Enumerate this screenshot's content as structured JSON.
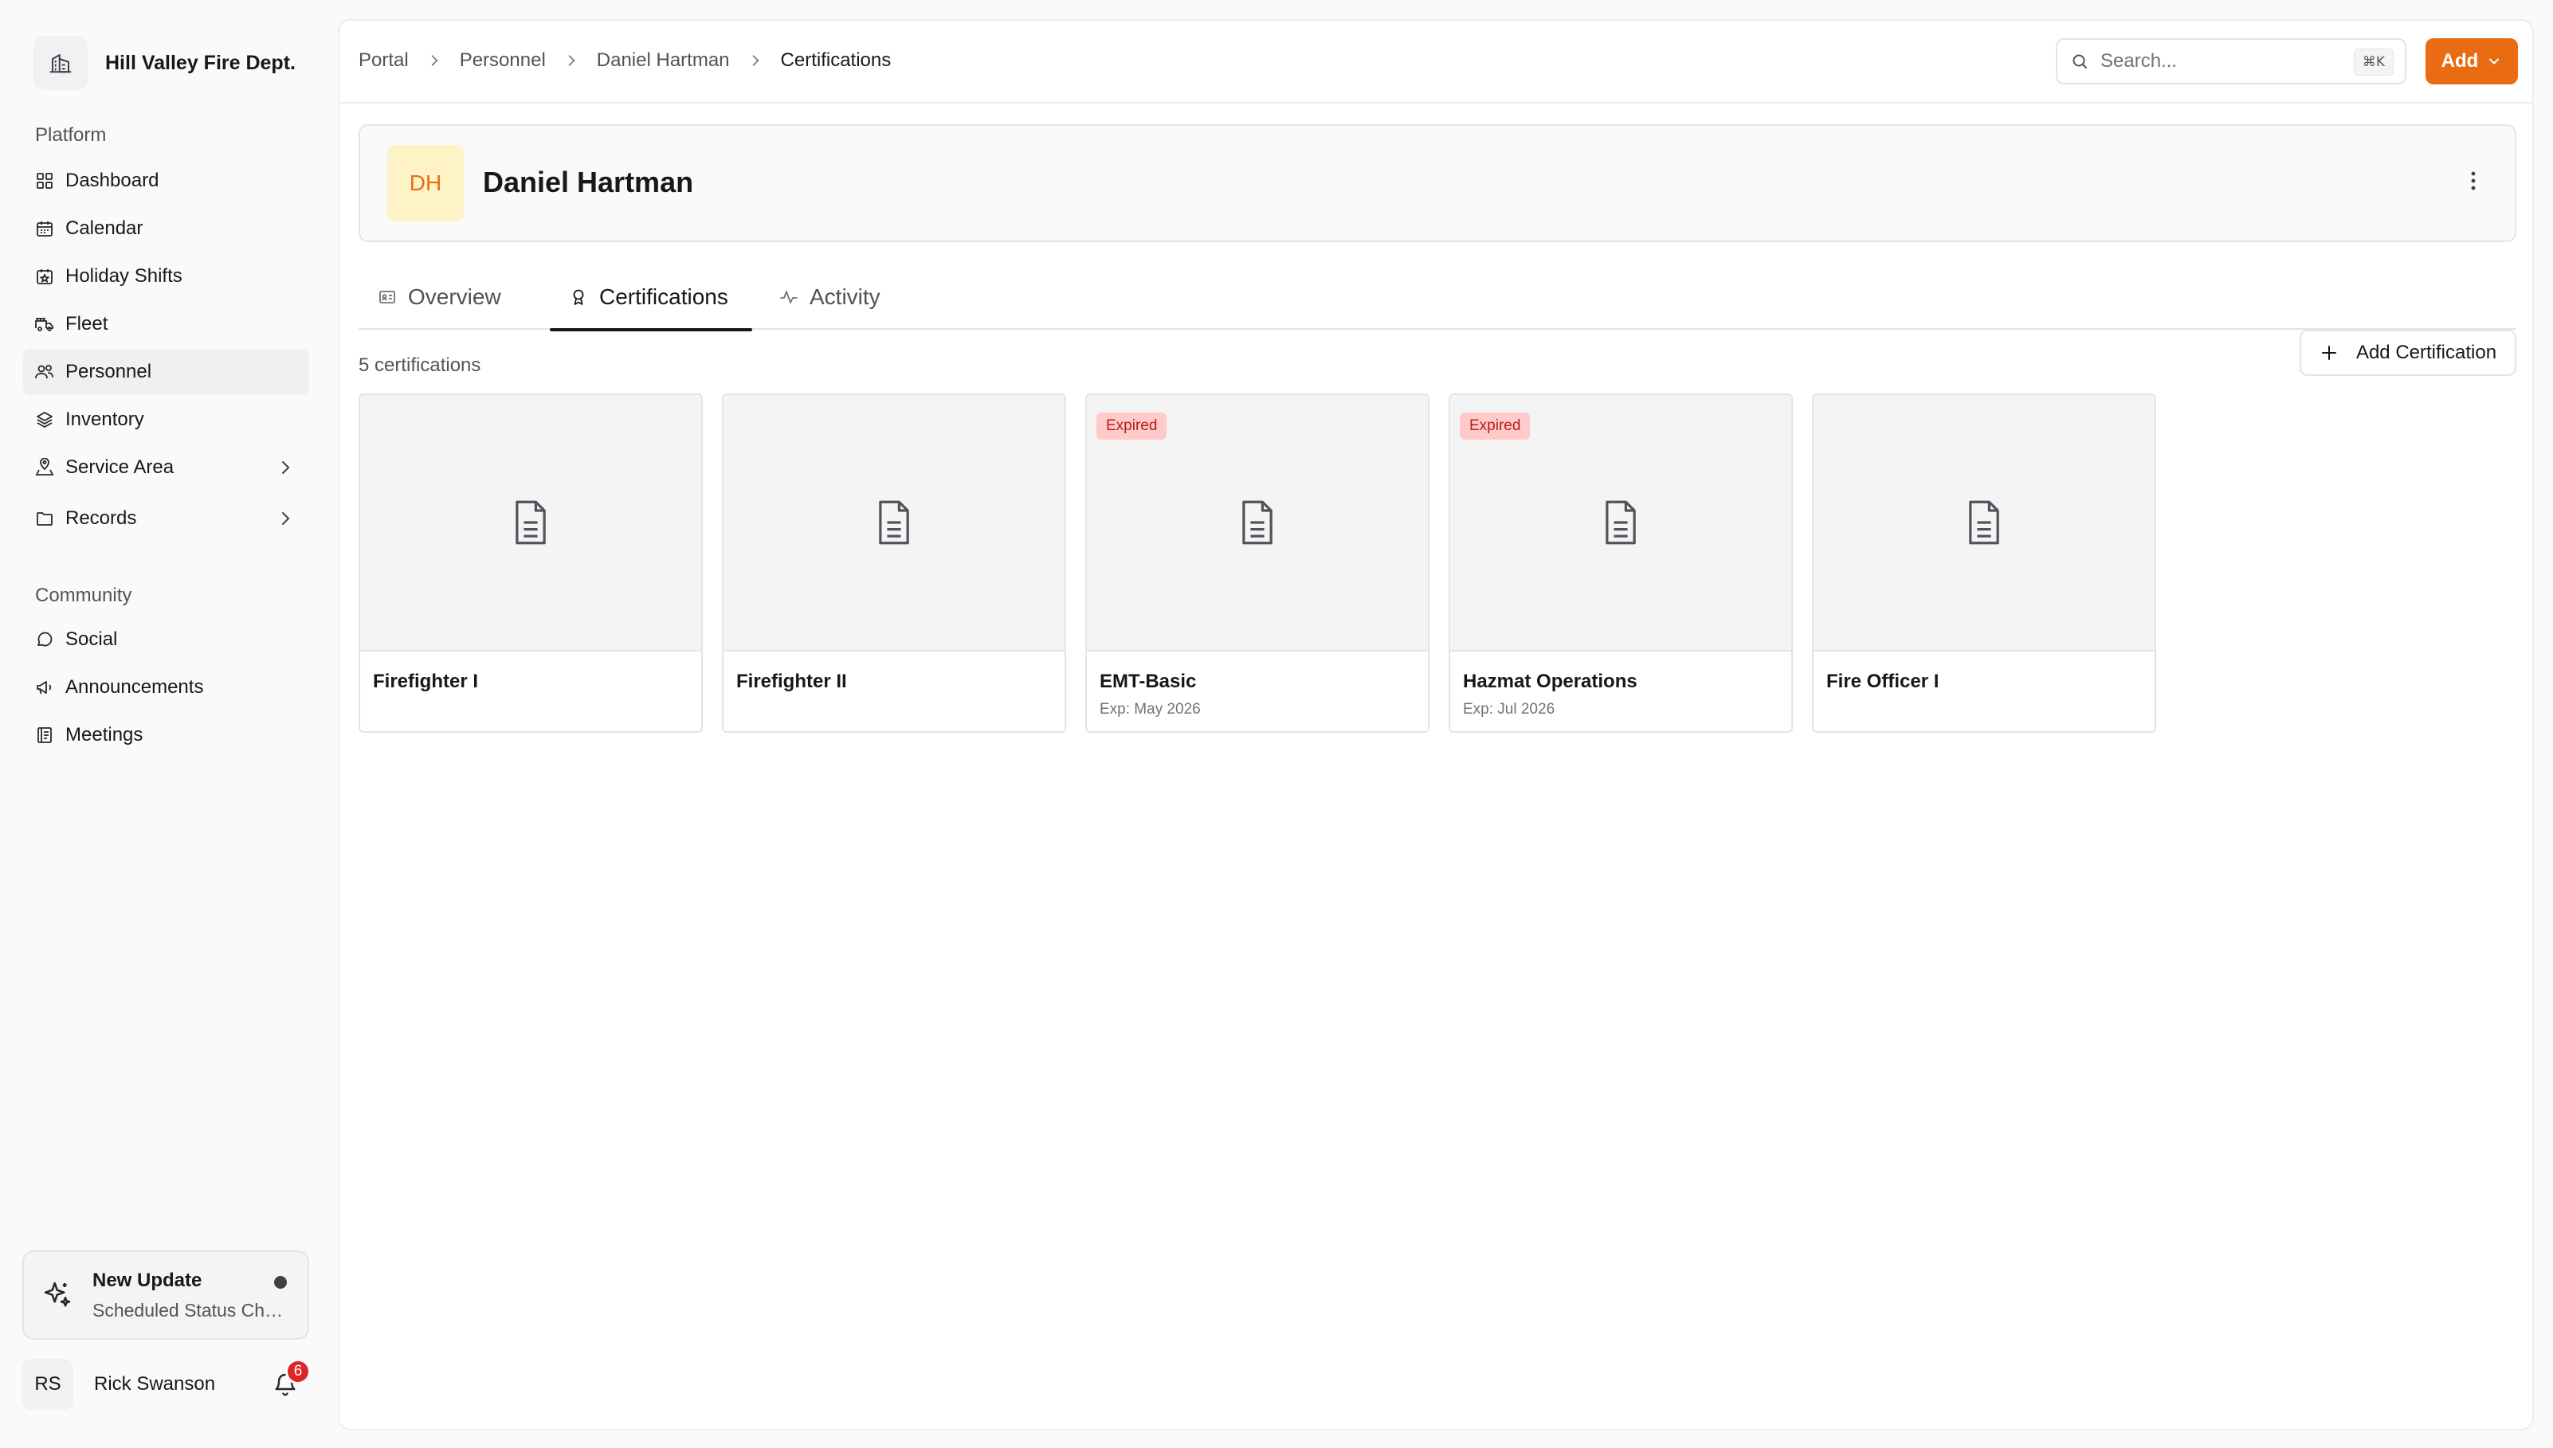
{
  "org": {
    "name": "Hill Valley Fire Dept."
  },
  "sidebar": {
    "platform_label": "Platform",
    "community_label": "Community",
    "platform_items": [
      {
        "label": "Dashboard",
        "icon": "dashboard-icon"
      },
      {
        "label": "Calendar",
        "icon": "calendar-icon"
      },
      {
        "label": "Holiday Shifts",
        "icon": "holiday-calendar-icon"
      },
      {
        "label": "Fleet",
        "icon": "fire-truck-icon"
      },
      {
        "label": "Personnel",
        "icon": "users-icon",
        "active": true
      },
      {
        "label": "Inventory",
        "icon": "layers-icon"
      },
      {
        "label": "Service Area",
        "icon": "map-pin-icon",
        "expandable": true
      },
      {
        "label": "Records",
        "icon": "folder-icon",
        "expandable": true
      }
    ],
    "community_items": [
      {
        "label": "Social",
        "icon": "chat-icon"
      },
      {
        "label": "Announcements",
        "icon": "megaphone-icon"
      },
      {
        "label": "Meetings",
        "icon": "notes-icon"
      }
    ],
    "update": {
      "title": "New Update",
      "subtitle": "Scheduled Status Changes"
    },
    "user": {
      "initials": "RS",
      "name": "Rick Swanson",
      "notifications": "6"
    }
  },
  "breadcrumb": [
    "Portal",
    "Personnel",
    "Daniel Hartman",
    "Certifications"
  ],
  "search": {
    "placeholder": "Search...",
    "shortcut": "⌘K"
  },
  "add_button": {
    "label": "Add"
  },
  "profile": {
    "initials": "DH",
    "name": "Daniel Hartman"
  },
  "tabs": [
    {
      "label": "Overview",
      "icon": "id-card-icon"
    },
    {
      "label": "Certifications",
      "icon": "award-icon",
      "active": true
    },
    {
      "label": "Activity",
      "icon": "activity-icon"
    }
  ],
  "certifications": {
    "count_label": "5 certifications",
    "add_label": "Add Certification",
    "items": [
      {
        "title": "Firefighter I",
        "badge": "",
        "expiry": ""
      },
      {
        "title": "Firefighter II",
        "badge": "",
        "expiry": ""
      },
      {
        "title": "EMT-Basic",
        "badge": "Expired",
        "expiry": "Exp: May 2026"
      },
      {
        "title": "Hazmat Operations",
        "badge": "Expired",
        "expiry": "Exp: Jul 2026"
      },
      {
        "title": "Fire Officer I",
        "badge": "",
        "expiry": ""
      }
    ]
  },
  "colors": {
    "accent": "#ea6c12",
    "expired_bg": "#fecaca",
    "expired_text": "#b91c1c",
    "badge_red": "#dc2626"
  }
}
